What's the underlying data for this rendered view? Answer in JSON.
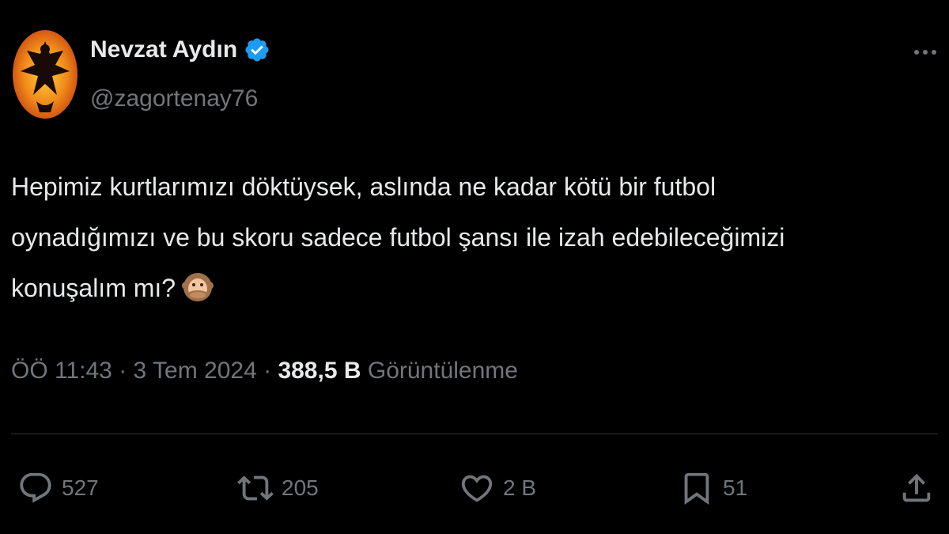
{
  "author": {
    "display_name": "Nevzat Aydın",
    "handle": "@zagortenay76",
    "verified": true,
    "avatar_icon": "phoenix-emblem-icon"
  },
  "tweet": {
    "lines": [
      "Hepimiz kurtlarımızı döktüysek, aslında ne kadar kötü bir futbol",
      "oynadığımızı ve bu skoru sadece futbol şansı ile izah edebileceğimizi",
      "konuşalım mı?"
    ],
    "emoji_icon": "speak-no-evil-monkey-icon"
  },
  "meta": {
    "time": "ÖÖ 11:43",
    "separator": " · ",
    "date": "3 Tem 2024",
    "views_count": "388,5 B",
    "views_label": "Görüntülenme"
  },
  "actions": {
    "reply_count": "527",
    "repost_count": "205",
    "like_count": "2 B",
    "bookmark_count": "51"
  },
  "colors": {
    "background": "#000000",
    "text": "#e7e9ea",
    "muted": "#71767b",
    "verified": "#1d9bf0",
    "divider": "#2f3336"
  }
}
